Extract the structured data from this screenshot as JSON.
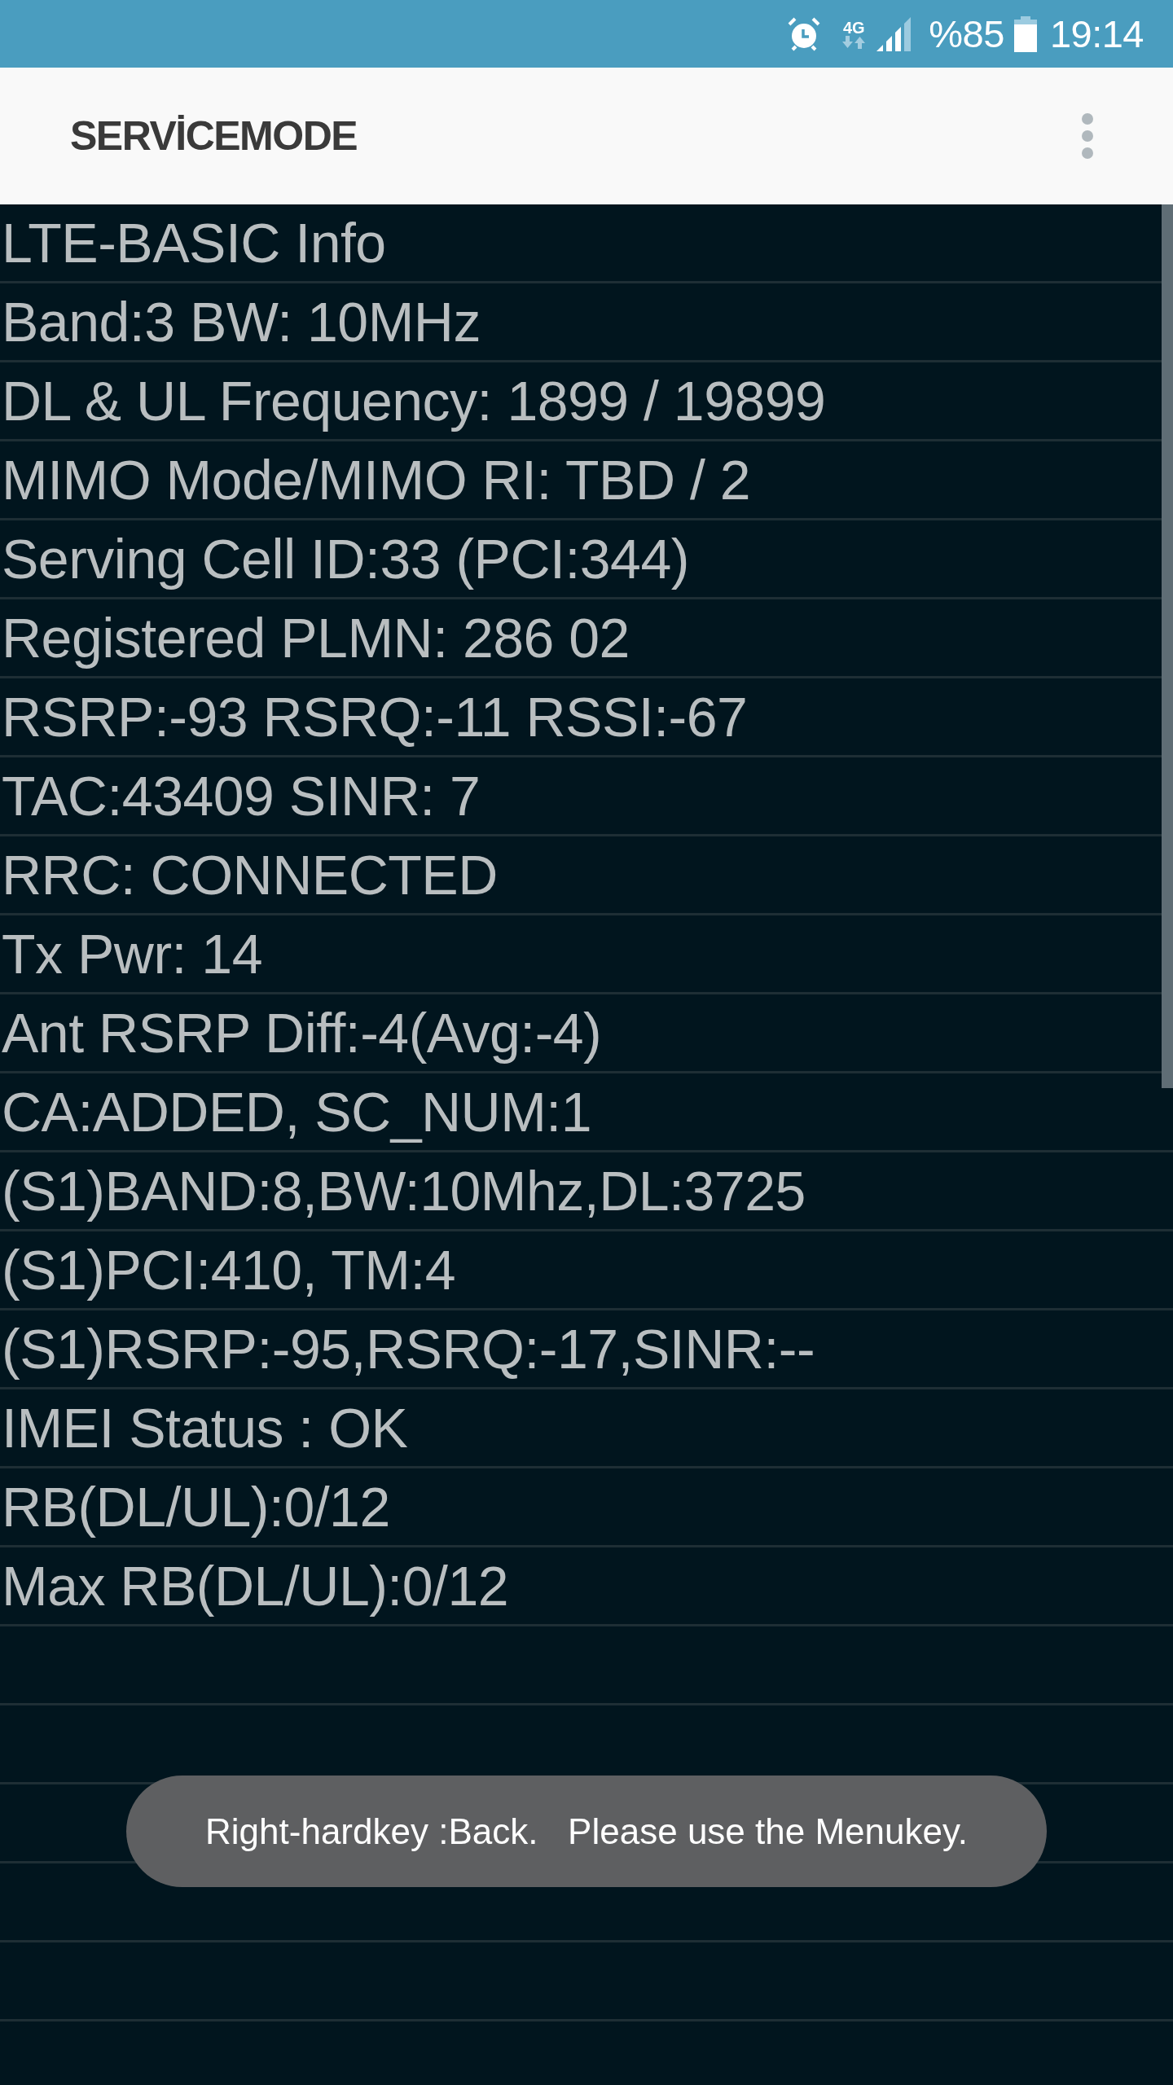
{
  "status_bar": {
    "network_type": "4G",
    "battery": "%85",
    "time": "19:14"
  },
  "app_bar": {
    "title": "SERVİCEMODE"
  },
  "info_rows": [
    "LTE-BASIC Info",
    "Band:3 BW: 10MHz",
    "DL & UL Frequency: 1899 / 19899",
    "MIMO Mode/MIMO RI: TBD / 2",
    "Serving Cell ID:33 (PCI:344)",
    "Registered PLMN: 286 02",
    "RSRP:-93 RSRQ:-11 RSSI:-67",
    "TAC:43409 SINR: 7",
    "RRC: CONNECTED",
    "Tx Pwr: 14",
    "Ant RSRP Diff:-4(Avg:-4)",
    "CA:ADDED, SC_NUM:1",
    "(S1)BAND:8,BW:10Mhz,DL:3725",
    "(S1)PCI:410, TM:4",
    "(S1)RSRP:-95,RSRQ:-17,SINR:--",
    "IMEI Status : OK",
    "RB(DL/UL):0/12",
    "Max RB(DL/UL):0/12"
  ],
  "toast": {
    "message": "Right-hardkey :Back.   Please use the Menukey."
  }
}
